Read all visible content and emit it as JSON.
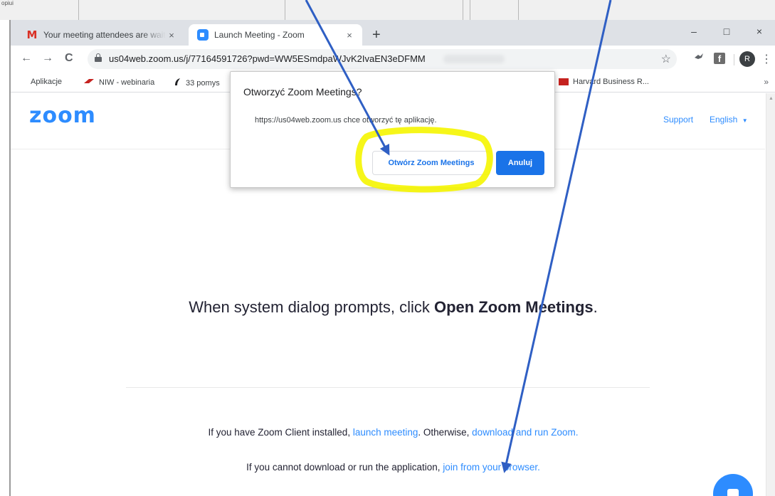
{
  "background": {
    "label": "opiui"
  },
  "tabs": [
    {
      "title": "Your meeting attendees are waiti",
      "favicon": "gmail-icon",
      "close": "×",
      "active": false
    },
    {
      "title": "Launch Meeting - Zoom",
      "favicon": "zoom-icon",
      "close": "×",
      "active": true
    }
  ],
  "new_tab": "+",
  "window_controls": {
    "minimize": "–",
    "maximize": "□",
    "close": "×"
  },
  "toolbar": {
    "back": "←",
    "forward": "→",
    "reload": "C",
    "url": "us04web.zoom.us/j/77164591726?pwd=WW5ESmdpaWJvK2IvaEN3eDFMM",
    "star": "☆",
    "avatar_letter": "R",
    "facebook_letter": "f",
    "menu": "⋮"
  },
  "bookmarks": {
    "items": [
      {
        "label": "Aplikacje",
        "icon": "apps-grid-icon"
      },
      {
        "label": "NIW - webinaria",
        "icon": "niw-icon"
      },
      {
        "label": "33 pomys",
        "icon": "bookmark-icon"
      },
      {
        "label": "Harvard Business R...",
        "icon": "hbr-icon"
      }
    ],
    "more": "»"
  },
  "page": {
    "logo": "zoom",
    "support": "Support",
    "language": "English",
    "message_pre": "When system dialog prompts, click ",
    "message_bold": "Open Zoom Meetings",
    "message_post": ".",
    "line1_pre": "If you have Zoom Client installed, ",
    "line1_link1": "launch meeting",
    "line1_mid": ". Otherwise, ",
    "line1_link2": "download and run Zoom.",
    "line2_pre": "If you cannot download or run the application, ",
    "line2_link": "join from your browser."
  },
  "dialog": {
    "title": "Otworzyć Zoom Meetings?",
    "message": "https://us04web.zoom.us chce otworzyć tę aplikację.",
    "open_label": "Otwórz Zoom Meetings",
    "cancel_label": "Anuluj"
  },
  "colors": {
    "zoom_blue": "#2d8cff",
    "chrome_blue": "#1a73e8",
    "highlight": "#f5f500",
    "arrow": "#2f5fc4"
  }
}
